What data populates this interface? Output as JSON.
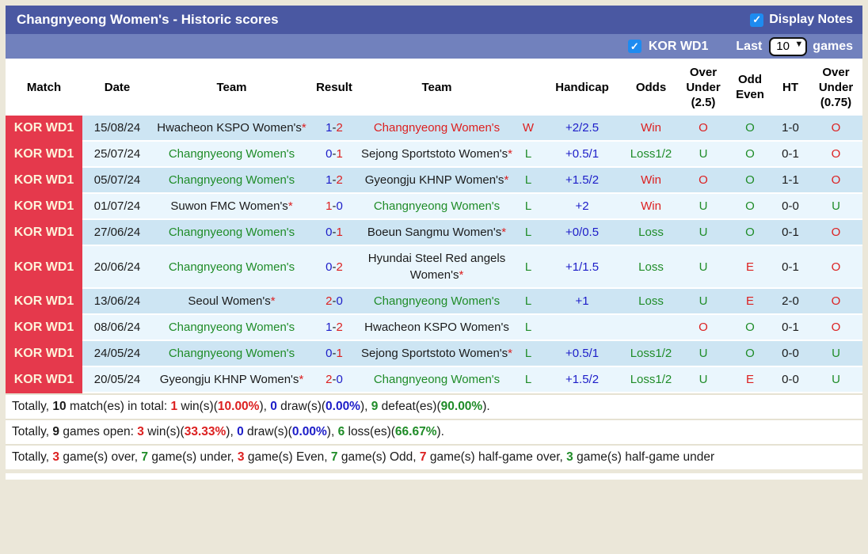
{
  "colors": {
    "red": "#dc2020",
    "blue": "#1c1cc8",
    "green": "#1f8c28",
    "black": "#1b1b1b"
  },
  "header": {
    "title": "Changnyeong Women's - Historic scores",
    "display_notes_label": "Display Notes",
    "display_notes_checked": true
  },
  "filter": {
    "league_label": "KOR WD1",
    "league_checked": true,
    "last_label": "Last",
    "games_label": "games",
    "last_value": "10",
    "last_options": [
      "10"
    ]
  },
  "table": {
    "columns": [
      "Match",
      "Date",
      "Team",
      "Result",
      "Team",
      "",
      "Handicap",
      "Odds",
      "Over\nUnder\n(2.5)",
      "Odd\nEven",
      "HT",
      "Over\nUnder\n(0.75)"
    ],
    "rows": [
      {
        "match": "KOR WD1",
        "date": "15/08/24",
        "home": {
          "name": "Hwacheon KSPO Women's",
          "star": true,
          "color": "black"
        },
        "score": {
          "home": "1",
          "away": "2",
          "home_color": "blue",
          "away_color": "red"
        },
        "away": {
          "name": "Changnyeong Women's",
          "star": false,
          "color": "red"
        },
        "wl": {
          "text": "W",
          "color": "red"
        },
        "handicap": "+2/2.5",
        "odds": {
          "text": "Win",
          "color": "red"
        },
        "ou25": {
          "text": "O",
          "color": "red"
        },
        "oddeven": {
          "text": "O",
          "color": "green"
        },
        "ht": "1-0",
        "ou075": {
          "text": "O",
          "color": "red"
        }
      },
      {
        "match": "KOR WD1",
        "date": "25/07/24",
        "home": {
          "name": "Changnyeong Women's",
          "star": false,
          "color": "green"
        },
        "score": {
          "home": "0",
          "away": "1",
          "home_color": "blue",
          "away_color": "red"
        },
        "away": {
          "name": "Sejong Sportstoto Women's",
          "star": true,
          "color": "black"
        },
        "wl": {
          "text": "L",
          "color": "green"
        },
        "handicap": "+0.5/1",
        "odds": {
          "text": "Loss1/2",
          "color": "green"
        },
        "ou25": {
          "text": "U",
          "color": "green"
        },
        "oddeven": {
          "text": "O",
          "color": "green"
        },
        "ht": "0-1",
        "ou075": {
          "text": "O",
          "color": "red"
        }
      },
      {
        "match": "KOR WD1",
        "date": "05/07/24",
        "home": {
          "name": "Changnyeong Women's",
          "star": false,
          "color": "green"
        },
        "score": {
          "home": "1",
          "away": "2",
          "home_color": "blue",
          "away_color": "red"
        },
        "away": {
          "name": "Gyeongju KHNP Women's",
          "star": true,
          "color": "black"
        },
        "wl": {
          "text": "L",
          "color": "green"
        },
        "handicap": "+1.5/2",
        "odds": {
          "text": "Win",
          "color": "red"
        },
        "ou25": {
          "text": "O",
          "color": "red"
        },
        "oddeven": {
          "text": "O",
          "color": "green"
        },
        "ht": "1-1",
        "ou075": {
          "text": "O",
          "color": "red"
        }
      },
      {
        "match": "KOR WD1",
        "date": "01/07/24",
        "home": {
          "name": "Suwon FMC Women's",
          "star": true,
          "color": "black"
        },
        "score": {
          "home": "1",
          "away": "0",
          "home_color": "red",
          "away_color": "blue"
        },
        "away": {
          "name": "Changnyeong Women's",
          "star": false,
          "color": "green"
        },
        "wl": {
          "text": "L",
          "color": "green"
        },
        "handicap": "+2",
        "odds": {
          "text": "Win",
          "color": "red"
        },
        "ou25": {
          "text": "U",
          "color": "green"
        },
        "oddeven": {
          "text": "O",
          "color": "green"
        },
        "ht": "0-0",
        "ou075": {
          "text": "U",
          "color": "green"
        }
      },
      {
        "match": "KOR WD1",
        "date": "27/06/24",
        "home": {
          "name": "Changnyeong Women's",
          "star": false,
          "color": "green"
        },
        "score": {
          "home": "0",
          "away": "1",
          "home_color": "blue",
          "away_color": "red"
        },
        "away": {
          "name": "Boeun Sangmu Women's",
          "star": true,
          "color": "black"
        },
        "wl": {
          "text": "L",
          "color": "green"
        },
        "handicap": "+0/0.5",
        "odds": {
          "text": "Loss",
          "color": "green"
        },
        "ou25": {
          "text": "U",
          "color": "green"
        },
        "oddeven": {
          "text": "O",
          "color": "green"
        },
        "ht": "0-1",
        "ou075": {
          "text": "O",
          "color": "red"
        }
      },
      {
        "match": "KOR WD1",
        "date": "20/06/24",
        "home": {
          "name": "Changnyeong Women's",
          "star": false,
          "color": "green"
        },
        "score": {
          "home": "0",
          "away": "2",
          "home_color": "blue",
          "away_color": "red"
        },
        "away": {
          "name": "Hyundai Steel Red angels Women's",
          "star": true,
          "color": "black"
        },
        "wl": {
          "text": "L",
          "color": "green"
        },
        "handicap": "+1/1.5",
        "odds": {
          "text": "Loss",
          "color": "green"
        },
        "ou25": {
          "text": "U",
          "color": "green"
        },
        "oddeven": {
          "text": "E",
          "color": "red"
        },
        "ht": "0-1",
        "ou075": {
          "text": "O",
          "color": "red"
        }
      },
      {
        "match": "KOR WD1",
        "date": "13/06/24",
        "home": {
          "name": "Seoul Women's",
          "star": true,
          "color": "black"
        },
        "score": {
          "home": "2",
          "away": "0",
          "home_color": "red",
          "away_color": "blue"
        },
        "away": {
          "name": "Changnyeong Women's",
          "star": false,
          "color": "green"
        },
        "wl": {
          "text": "L",
          "color": "green"
        },
        "handicap": "+1",
        "odds": {
          "text": "Loss",
          "color": "green"
        },
        "ou25": {
          "text": "U",
          "color": "green"
        },
        "oddeven": {
          "text": "E",
          "color": "red"
        },
        "ht": "2-0",
        "ou075": {
          "text": "O",
          "color": "red"
        }
      },
      {
        "match": "KOR WD1",
        "date": "08/06/24",
        "home": {
          "name": "Changnyeong Women's",
          "star": false,
          "color": "green"
        },
        "score": {
          "home": "1",
          "away": "2",
          "home_color": "blue",
          "away_color": "red"
        },
        "away": {
          "name": "Hwacheon KSPO Women's",
          "star": false,
          "color": "black"
        },
        "wl": {
          "text": "L",
          "color": "green"
        },
        "handicap": "",
        "odds": {
          "text": "",
          "color": "black"
        },
        "ou25": {
          "text": "O",
          "color": "red"
        },
        "oddeven": {
          "text": "O",
          "color": "green"
        },
        "ht": "0-1",
        "ou075": {
          "text": "O",
          "color": "red"
        }
      },
      {
        "match": "KOR WD1",
        "date": "24/05/24",
        "home": {
          "name": "Changnyeong Women's",
          "star": false,
          "color": "green"
        },
        "score": {
          "home": "0",
          "away": "1",
          "home_color": "blue",
          "away_color": "red"
        },
        "away": {
          "name": "Sejong Sportstoto Women's",
          "star": true,
          "color": "black"
        },
        "wl": {
          "text": "L",
          "color": "green"
        },
        "handicap": "+0.5/1",
        "odds": {
          "text": "Loss1/2",
          "color": "green"
        },
        "ou25": {
          "text": "U",
          "color": "green"
        },
        "oddeven": {
          "text": "O",
          "color": "green"
        },
        "ht": "0-0",
        "ou075": {
          "text": "U",
          "color": "green"
        }
      },
      {
        "match": "KOR WD1",
        "date": "20/05/24",
        "home": {
          "name": "Gyeongju KHNP Women's",
          "star": true,
          "color": "black"
        },
        "score": {
          "home": "2",
          "away": "0",
          "home_color": "red",
          "away_color": "blue"
        },
        "away": {
          "name": "Changnyeong Women's",
          "star": false,
          "color": "green"
        },
        "wl": {
          "text": "L",
          "color": "green"
        },
        "handicap": "+1.5/2",
        "odds": {
          "text": "Loss1/2",
          "color": "green"
        },
        "ou25": {
          "text": "U",
          "color": "green"
        },
        "oddeven": {
          "text": "E",
          "color": "red"
        },
        "ht": "0-0",
        "ou075": {
          "text": "U",
          "color": "green"
        }
      }
    ]
  },
  "footer": {
    "lines": [
      [
        {
          "t": "Totally, ",
          "c": "black",
          "b": false
        },
        {
          "t": "10",
          "c": "black",
          "b": true
        },
        {
          "t": " match(es) in total: ",
          "c": "black",
          "b": false
        },
        {
          "t": "1",
          "c": "red",
          "b": true
        },
        {
          "t": " win(s)(",
          "c": "black",
          "b": false
        },
        {
          "t": "10.00%",
          "c": "red",
          "b": true
        },
        {
          "t": "), ",
          "c": "black",
          "b": false
        },
        {
          "t": "0",
          "c": "blue",
          "b": true
        },
        {
          "t": " draw(s)(",
          "c": "black",
          "b": false
        },
        {
          "t": "0.00%",
          "c": "blue",
          "b": true
        },
        {
          "t": "), ",
          "c": "black",
          "b": false
        },
        {
          "t": "9",
          "c": "green",
          "b": true
        },
        {
          "t": " defeat(es)(",
          "c": "black",
          "b": false
        },
        {
          "t": "90.00%",
          "c": "green",
          "b": true
        },
        {
          "t": ").",
          "c": "black",
          "b": false
        }
      ],
      [
        {
          "t": "Totally, ",
          "c": "black",
          "b": false
        },
        {
          "t": "9",
          "c": "black",
          "b": true
        },
        {
          "t": " games open: ",
          "c": "black",
          "b": false
        },
        {
          "t": "3",
          "c": "red",
          "b": true
        },
        {
          "t": " win(s)(",
          "c": "black",
          "b": false
        },
        {
          "t": "33.33%",
          "c": "red",
          "b": true
        },
        {
          "t": "), ",
          "c": "black",
          "b": false
        },
        {
          "t": "0",
          "c": "blue",
          "b": true
        },
        {
          "t": " draw(s)(",
          "c": "black",
          "b": false
        },
        {
          "t": "0.00%",
          "c": "blue",
          "b": true
        },
        {
          "t": "), ",
          "c": "black",
          "b": false
        },
        {
          "t": "6",
          "c": "green",
          "b": true
        },
        {
          "t": " loss(es)(",
          "c": "black",
          "b": false
        },
        {
          "t": "66.67%",
          "c": "green",
          "b": true
        },
        {
          "t": ").",
          "c": "black",
          "b": false
        }
      ],
      [
        {
          "t": "Totally, ",
          "c": "black",
          "b": false
        },
        {
          "t": "3",
          "c": "red",
          "b": true
        },
        {
          "t": " game(s) over, ",
          "c": "black",
          "b": false
        },
        {
          "t": "7",
          "c": "green",
          "b": true
        },
        {
          "t": " game(s) under, ",
          "c": "black",
          "b": false
        },
        {
          "t": "3",
          "c": "red",
          "b": true
        },
        {
          "t": " game(s) Even, ",
          "c": "black",
          "b": false
        },
        {
          "t": "7",
          "c": "green",
          "b": true
        },
        {
          "t": " game(s) Odd, ",
          "c": "black",
          "b": false
        },
        {
          "t": "7",
          "c": "red",
          "b": true
        },
        {
          "t": " game(s) half-game over, ",
          "c": "black",
          "b": false
        },
        {
          "t": "3",
          "c": "green",
          "b": true
        },
        {
          "t": " game(s) half-game under",
          "c": "black",
          "b": false
        }
      ]
    ]
  }
}
